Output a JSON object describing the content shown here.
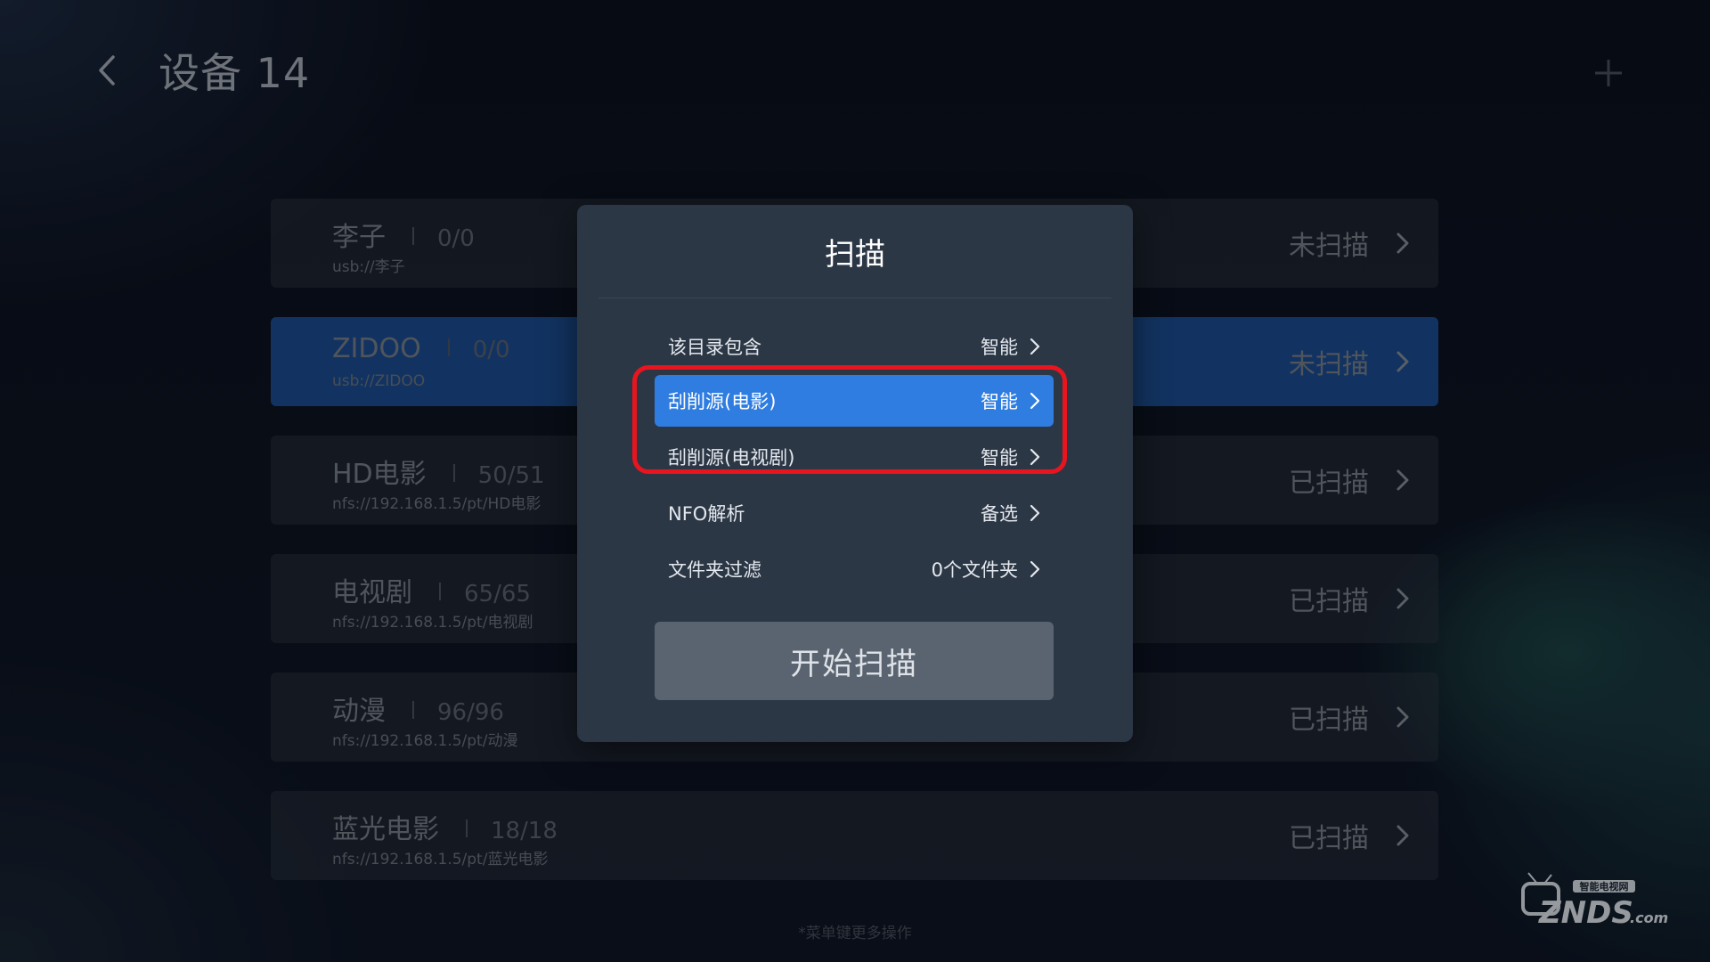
{
  "header": {
    "title": "设备 14"
  },
  "rows": [
    {
      "name": "李子",
      "count": "0/0",
      "path": "usb://李子",
      "status": "未扫描",
      "active": false
    },
    {
      "name": "ZIDOO",
      "count": "0/0",
      "path": "usb://ZIDOO",
      "status": "未扫描",
      "active": true
    },
    {
      "name": "HD电影",
      "count": "50/51",
      "path": "nfs://192.168.1.5/pt/HD电影",
      "status": "已扫描",
      "active": false
    },
    {
      "name": "电视剧",
      "count": "65/65",
      "path": "nfs://192.168.1.5/pt/电视剧",
      "status": "已扫描",
      "active": false
    },
    {
      "name": "动漫",
      "count": "96/96",
      "path": "nfs://192.168.1.5/pt/动漫",
      "status": "已扫描",
      "active": false
    },
    {
      "name": "蓝光电影",
      "count": "18/18",
      "path": "nfs://192.168.1.5/pt/蓝光电影",
      "status": "已扫描",
      "active": false
    }
  ],
  "dialog": {
    "title": "扫描",
    "options": [
      {
        "label": "该目录包含",
        "value": "智能",
        "selected": false
      },
      {
        "label": "刮削源(电影)",
        "value": "智能",
        "selected": true
      },
      {
        "label": "刮削源(电视剧)",
        "value": "智能",
        "selected": false
      },
      {
        "label": "NFO解析",
        "value": "备选",
        "selected": false
      },
      {
        "label": "文件夹过滤",
        "value": "0个文件夹",
        "selected": false
      }
    ],
    "start_button": "开始扫描"
  },
  "hint": "*菜单键更多操作",
  "logo": {
    "text": "ZNDS.com",
    "subtext": "智能电视网"
  },
  "colors": {
    "accent": "#2f7de0",
    "row_active": "#1d4f96",
    "highlight": "#e8151f"
  }
}
